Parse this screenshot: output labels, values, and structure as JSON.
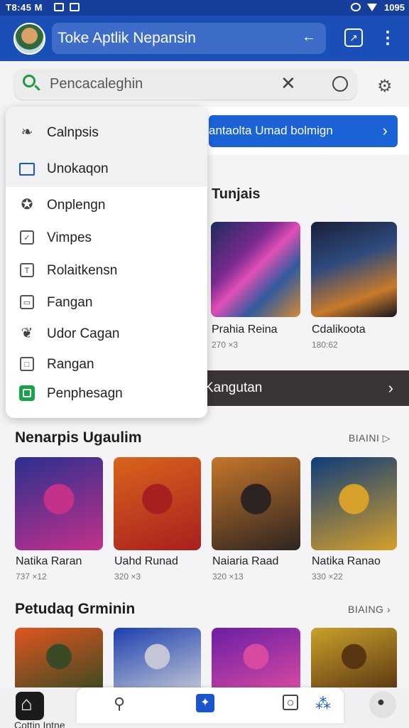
{
  "status_bar": {
    "time": "T8:45 M",
    "battery": "1095"
  },
  "app_bar": {
    "title": "Toke Aptlik Nepansin",
    "arrow": "←",
    "compose_icon": "edit-square-icon",
    "more_icon": "more-vert-icon"
  },
  "search": {
    "placeholder": "Pencacaleghin",
    "clear": "✕"
  },
  "banner": {
    "text": "antaolta Umad bolmign",
    "chevron": "›"
  },
  "dropdown_menu": {
    "items": [
      {
        "label": "Calnpsis",
        "icon": "feather-icon"
      },
      {
        "label": "Unokaqon",
        "icon": "window-icon"
      },
      {
        "label": "Onplengn",
        "icon": "badge-icon"
      },
      {
        "label": "Vimpes",
        "icon": "checkbox-icon"
      },
      {
        "label": "Rolaitkensn",
        "icon": "text-box-icon"
      },
      {
        "label": "Fangan",
        "icon": "folder-icon"
      },
      {
        "label": "Udor Cagan",
        "icon": "leaf-icon"
      },
      {
        "label": "Rangan",
        "icon": "square-icon"
      },
      {
        "label": "Penphesagn",
        "icon": "green-app-icon"
      }
    ]
  },
  "section_top": {
    "title": "Tunjais",
    "games": [
      {
        "name": "Prahia Reina",
        "meta": "270 ×3"
      },
      {
        "name": "Cdalikoota",
        "meta": "180:62"
      }
    ],
    "strip_label": "Kangutan",
    "strip_chevron": "›"
  },
  "section_2": {
    "title": "Nenarpis Ugaulim",
    "see_all": "BIAINI ▷",
    "games": [
      {
        "name": "Natika Raran",
        "meta": "737 ×12",
        "colors": [
          "#2b2f8f",
          "#c2318a"
        ]
      },
      {
        "name": "Uahd Runad",
        "meta": "320 ×3",
        "colors": [
          "#d8641c",
          "#a81f1f"
        ]
      },
      {
        "name": "Naiaria Raad",
        "meta": "320 ×13",
        "colors": [
          "#c5762a",
          "#2d2421"
        ]
      },
      {
        "name": "Natika Ranao",
        "meta": "330 ×22",
        "colors": [
          "#0e3c7a",
          "#d6a02a"
        ]
      }
    ]
  },
  "section_3": {
    "title": "Petudaq Grminin",
    "see_all": "BIAING ›",
    "games": [
      {
        "colors": [
          "#e0551f",
          "#3a4a22"
        ]
      },
      {
        "colors": [
          "#1c3fae",
          "#c2c6d6"
        ]
      },
      {
        "colors": [
          "#6a1ea5",
          "#d84aa1"
        ]
      },
      {
        "colors": [
          "#c9a12a",
          "#5a3512"
        ]
      }
    ]
  },
  "bottom_nav": {
    "items": [
      "home-icon",
      "search-icon",
      "games-icon",
      "tablet-icon",
      "share-icon",
      "profile-icon"
    ],
    "cut_text": "Cottin Intne"
  }
}
